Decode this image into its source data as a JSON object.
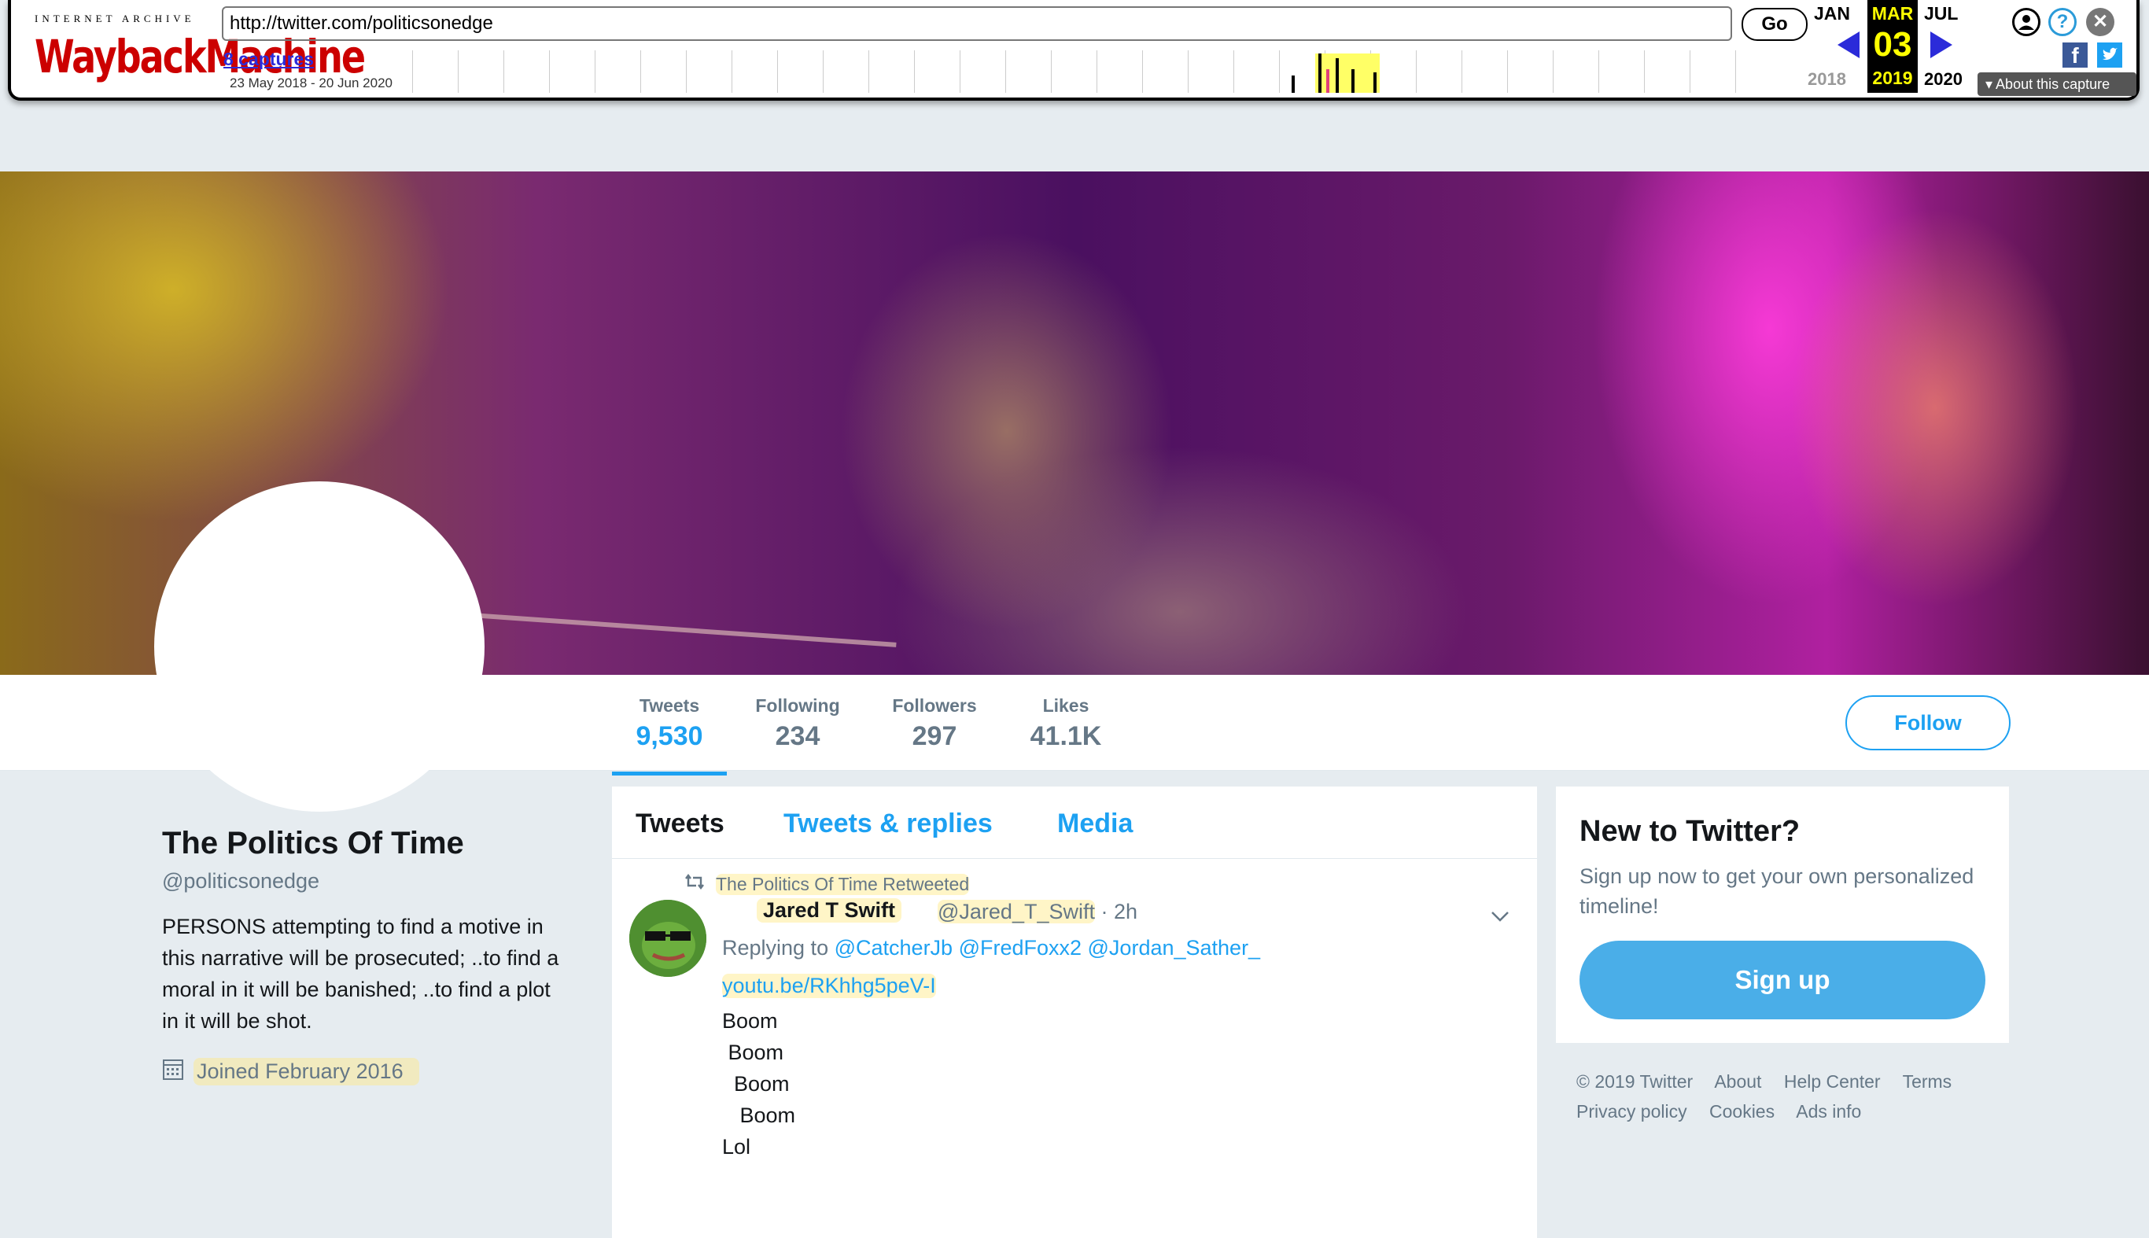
{
  "wayback": {
    "logo_top": "INTERNET ARCHIVE",
    "logo_main": "WaybackMachine",
    "url": "http://twitter.com/politicsonedge",
    "go_label": "Go",
    "captures": "8 captures",
    "range": "23 May 2018 - 20 Jun 2020",
    "prev_month": "JAN",
    "cur_month": "MAR",
    "next_month": "JUL",
    "cur_day": "03",
    "prev_year": "2018",
    "cur_year": "2019",
    "next_year": "2020",
    "about": "About this capture",
    "colors": {
      "logo_red": "#cc0000",
      "current_yellow": "#ffff00",
      "arrow_blue": "#2b2bd9"
    }
  },
  "profile": {
    "name": "The Politics Of Time",
    "handle": "@politicsonedge",
    "bio": "PERSONS attempting to find a motive in this narrative will be prosecuted; ..to find a moral in it will be banished; ..to find a plot in it will be shot.",
    "joined": "Joined February 2016",
    "joined_icon": "calendar-icon"
  },
  "stats": [
    {
      "label": "Tweets",
      "value": "9,530"
    },
    {
      "label": "Following",
      "value": "234"
    },
    {
      "label": "Followers",
      "value": "297"
    },
    {
      "label": "Likes",
      "value": "41.1K"
    }
  ],
  "follow_label": "Follow",
  "tabs": [
    "Tweets",
    "Tweets & replies",
    "Media"
  ],
  "tweet": {
    "retweet_context": "The Politics Of Time Retweeted",
    "author_name": "Jared T Swift",
    "author_handle": "@Jared_T_Swift",
    "time": "· 2h",
    "replying_prefix": "Replying to",
    "replying_to": "@CatcherJb @FredFoxx2 @Jordan_Sather_",
    "link": "youtu.be/RKhhg5peV-I",
    "body": "Boom\n Boom\n  Boom\n   Boom\nLol"
  },
  "signup": {
    "title": "New to Twitter?",
    "subtitle": "Sign up now to get your own personalized timeline!",
    "button": "Sign up"
  },
  "footer": [
    "© 2019 Twitter",
    "About",
    "Help Center",
    "Terms",
    "Privacy policy",
    "Cookies",
    "Ads info"
  ],
  "colors": {
    "twitter_blue": "#1da1f2",
    "page_bg": "#e6ecf0",
    "muted": "#657786"
  }
}
